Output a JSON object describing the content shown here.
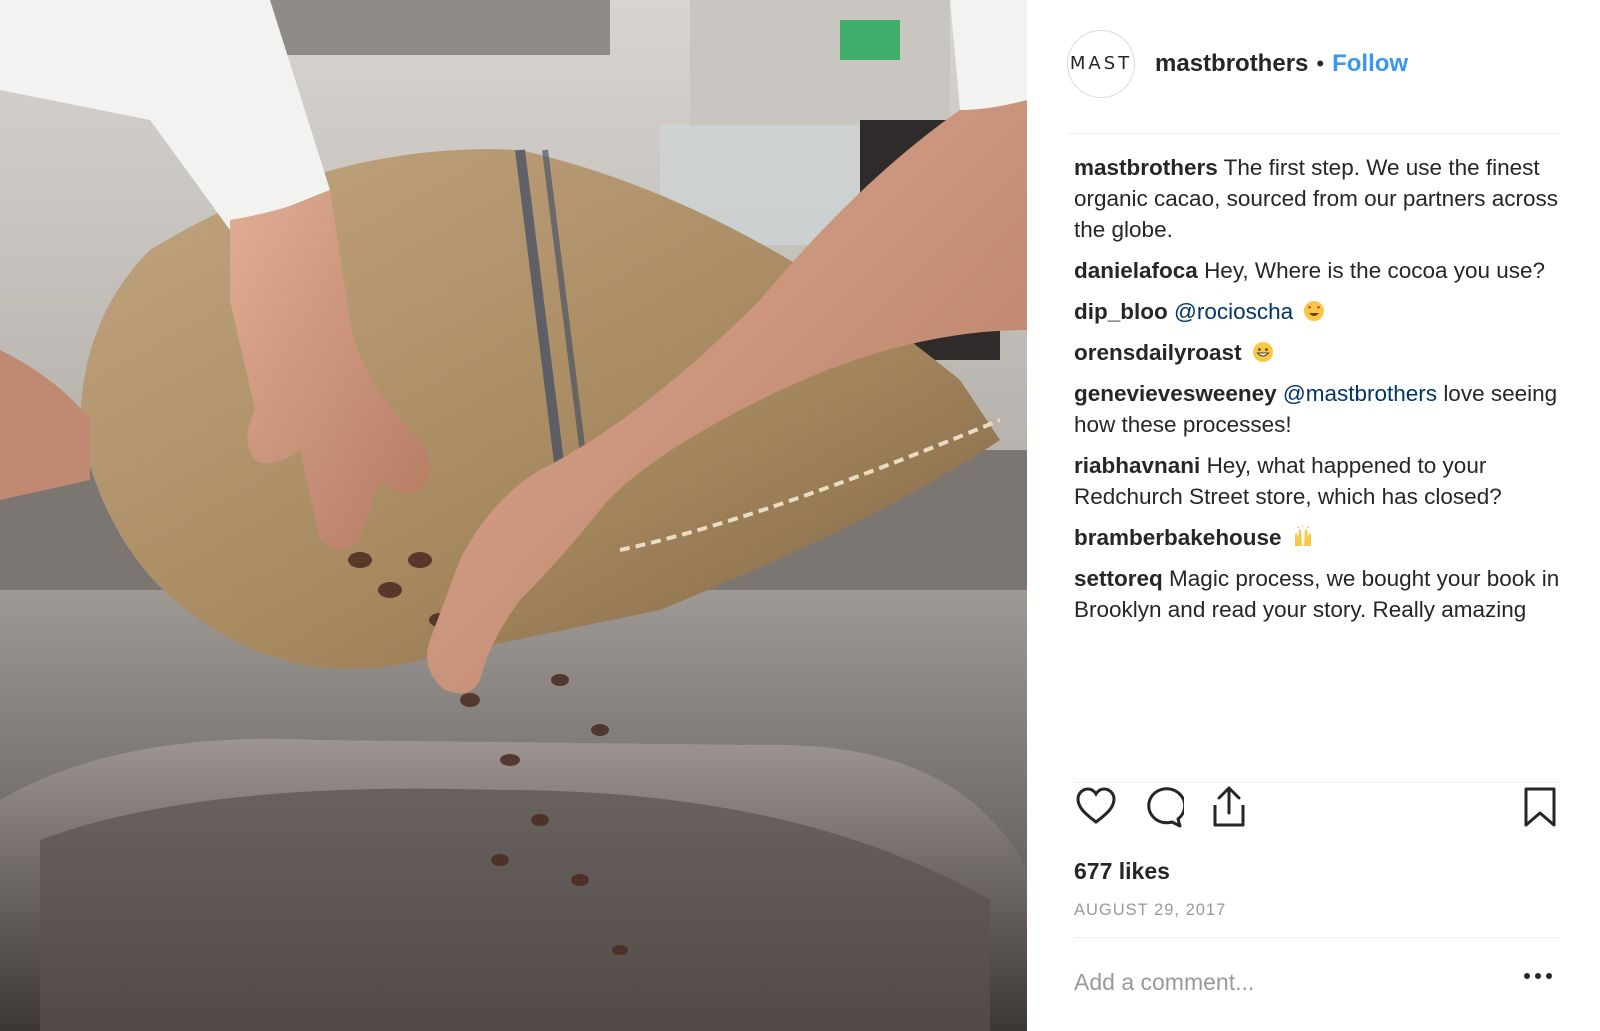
{
  "post": {
    "image_alt": "",
    "avatar_text": "MAST",
    "username": "mastbrothers",
    "separator": "•",
    "follow_label": "Follow"
  },
  "comments": [
    {
      "user": "mastbrothers",
      "parts": [
        {
          "t": "text",
          "v": "The first step. We use the finest organic cacao, sourced from our partners across the globe."
        }
      ]
    },
    {
      "user": "danielafoca",
      "parts": [
        {
          "t": "text",
          "v": "Hey, Where is the cocoa you use?"
        }
      ]
    },
    {
      "user": "dip_bloo",
      "parts": [
        {
          "t": "mention",
          "v": "@rocioscha"
        },
        {
          "t": "emoji",
          "v": "heart-eyes-emoji"
        }
      ]
    },
    {
      "user": "orensdailyroast",
      "parts": [
        {
          "t": "emoji",
          "v": "grinning-emoji"
        }
      ]
    },
    {
      "user": "genevievesweeney",
      "parts": [
        {
          "t": "mention",
          "v": "@mastbrothers"
        },
        {
          "t": "text",
          "v": "love seeing how these processes!"
        }
      ]
    },
    {
      "user": "riabhavnani",
      "parts": [
        {
          "t": "text",
          "v": "Hey, what happened to your Redchurch Street store, which has closed?"
        }
      ]
    },
    {
      "user": "bramberbakehouse",
      "parts": [
        {
          "t": "emoji",
          "v": "raising-hands-emoji"
        }
      ]
    },
    {
      "user": "settoreq",
      "parts": [
        {
          "t": "text",
          "v": "Magic process, we bought your book in Brooklyn and read your story. Really amazing"
        }
      ]
    }
  ],
  "actions": {
    "like_icon": "heart-icon",
    "comment_icon": "comment-bubble-icon",
    "share_icon": "share-icon",
    "save_icon": "bookmark-icon"
  },
  "likes": "677 likes",
  "date": "AUGUST 29, 2017",
  "add_comment": {
    "placeholder": "Add a comment..."
  },
  "more_icon": "more-dots-icon",
  "colors": {
    "link": "#3897f0",
    "mention": "#003569",
    "text": "#262626",
    "muted": "#999999",
    "divider": "#efefef"
  }
}
